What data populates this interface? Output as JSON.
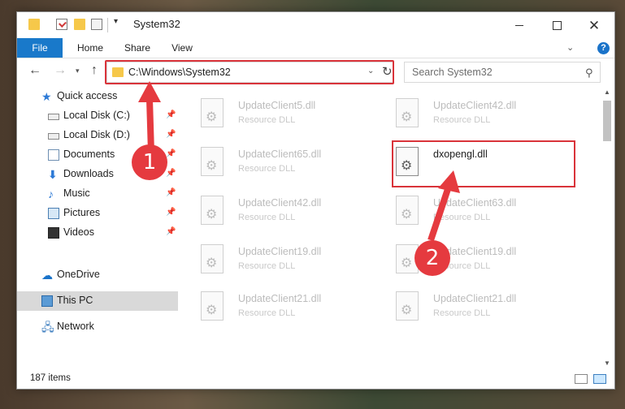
{
  "window": {
    "title": "System32",
    "controls": {
      "minimize": "—",
      "maximize": "□",
      "close": "✕"
    }
  },
  "ribbon": {
    "tabs": [
      "File",
      "Home",
      "Share",
      "View"
    ],
    "help": "?"
  },
  "navbar": {
    "address": "C:\\Windows\\System32",
    "search_placeholder": "Search System32"
  },
  "sidebar": {
    "items": [
      {
        "label": "Quick access",
        "icon": "star-icon",
        "pinned": false
      },
      {
        "label": "Local Disk (C:)",
        "icon": "drive-icon",
        "pinned": true
      },
      {
        "label": "Local Disk (D:)",
        "icon": "drive-icon",
        "pinned": true
      },
      {
        "label": "Documents",
        "icon": "documents-icon",
        "pinned": true
      },
      {
        "label": "Downloads",
        "icon": "download-icon",
        "pinned": true
      },
      {
        "label": "Music",
        "icon": "music-icon",
        "pinned": true
      },
      {
        "label": "Pictures",
        "icon": "pictures-icon",
        "pinned": true
      },
      {
        "label": "Videos",
        "icon": "videos-icon",
        "pinned": true
      },
      {
        "label": "OneDrive",
        "icon": "cloud-icon",
        "pinned": false
      },
      {
        "label": "This PC",
        "icon": "pc-icon",
        "pinned": false,
        "selected": true
      },
      {
        "label": "Network",
        "icon": "network-icon",
        "pinned": false
      }
    ]
  },
  "files": [
    {
      "name": "UpdateClient5.dll",
      "type": "Resource DLL"
    },
    {
      "name": "UpdateClient42.dll",
      "type": "Resource DLL"
    },
    {
      "name": "UpdateClient65.dll",
      "type": "Resource DLL"
    },
    {
      "name": "dxopengl.dll",
      "type": "",
      "highlighted": true
    },
    {
      "name": "UpdateClient42.dll",
      "type": "Resource DLL"
    },
    {
      "name": "UpdateClient63.dll",
      "type": "Resource DLL"
    },
    {
      "name": "UpdateClient19.dll",
      "type": "Resource DLL"
    },
    {
      "name": "UpdateClient19.dll",
      "type": "Resource DLL"
    },
    {
      "name": "UpdateClient21.dll",
      "type": "Resource DLL"
    },
    {
      "name": "UpdateClient21.dll",
      "type": "Resource DLL"
    }
  ],
  "status": {
    "item_count": "187 items"
  },
  "annotations": {
    "marker1": "1",
    "marker2": "2",
    "color": "#e53a3f"
  }
}
